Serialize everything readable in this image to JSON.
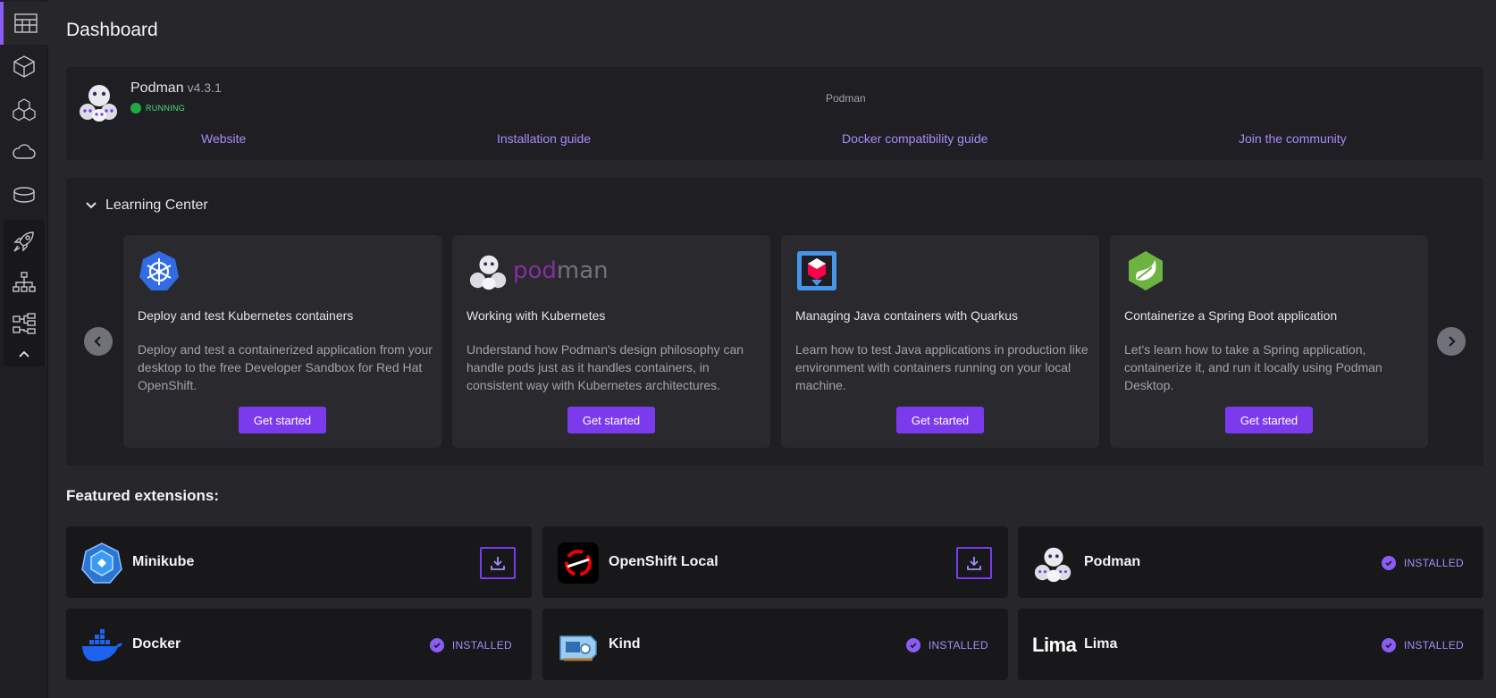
{
  "page": {
    "title": "Dashboard"
  },
  "sidebar": {
    "items": [
      {
        "icon": "dashboard-icon"
      },
      {
        "icon": "container-icon"
      },
      {
        "icon": "pods-icon"
      },
      {
        "icon": "cloud-icon"
      },
      {
        "icon": "volume-icon"
      }
    ],
    "extensions": [
      {
        "icon": "rocket-icon"
      },
      {
        "icon": "sitemap-icon"
      },
      {
        "icon": "diagram-icon"
      }
    ]
  },
  "podman": {
    "name": "Podman",
    "version": "v4.3.1",
    "status": "RUNNING",
    "center_label": "Podman",
    "links": [
      "Website",
      "Installation guide",
      "Docker compatibility guide",
      "Join the community"
    ],
    "status_color": "#22a846"
  },
  "learning_center": {
    "title": "Learning Center",
    "cards": [
      {
        "title": "Deploy and test Kubernetes containers",
        "description": "Deploy and test a containerized application from your desktop to the free Developer Sandbox for Red Hat OpenShift.",
        "button": "Get started",
        "logo": "kubernetes-logo"
      },
      {
        "title": "Working with Kubernetes",
        "description": "Understand how Podman's design philosophy can handle pods just as it handles containers, in consistent way with Kubernetes architectures.",
        "button": "Get started",
        "logo": "podman-wordmark-logo",
        "logo_text": {
          "a": "pod",
          "b": "man"
        }
      },
      {
        "title": "Managing Java containers with Quarkus",
        "description": "Learn how to test Java applications in production like environment with containers running on your local machine.",
        "button": "Get started",
        "logo": "quarkus-logo"
      },
      {
        "title": "Containerize a Spring Boot application",
        "description": "Let's learn how to take a Spring application, containerize it, and run it locally using Podman Desktop.",
        "button": "Get started",
        "logo": "spring-logo"
      }
    ]
  },
  "featured": {
    "title": "Featured extensions:",
    "installed_label": "INSTALLED",
    "extensions": [
      {
        "name": "Minikube",
        "state": "download",
        "logo": "minikube-logo"
      },
      {
        "name": "OpenShift Local",
        "state": "download",
        "logo": "openshift-logo"
      },
      {
        "name": "Podman",
        "state": "installed",
        "logo": "podman-logo"
      },
      {
        "name": "Docker",
        "state": "installed",
        "logo": "docker-logo"
      },
      {
        "name": "Kind",
        "state": "installed",
        "logo": "kind-logo"
      },
      {
        "name": "Lima",
        "state": "installed",
        "logo": "lima-logo",
        "logo_text": "Lima"
      }
    ]
  },
  "colors": {
    "accent": "#7c3aed",
    "link": "#a78bfa",
    "background": "#27272a",
    "panel": "#1f1f23"
  }
}
